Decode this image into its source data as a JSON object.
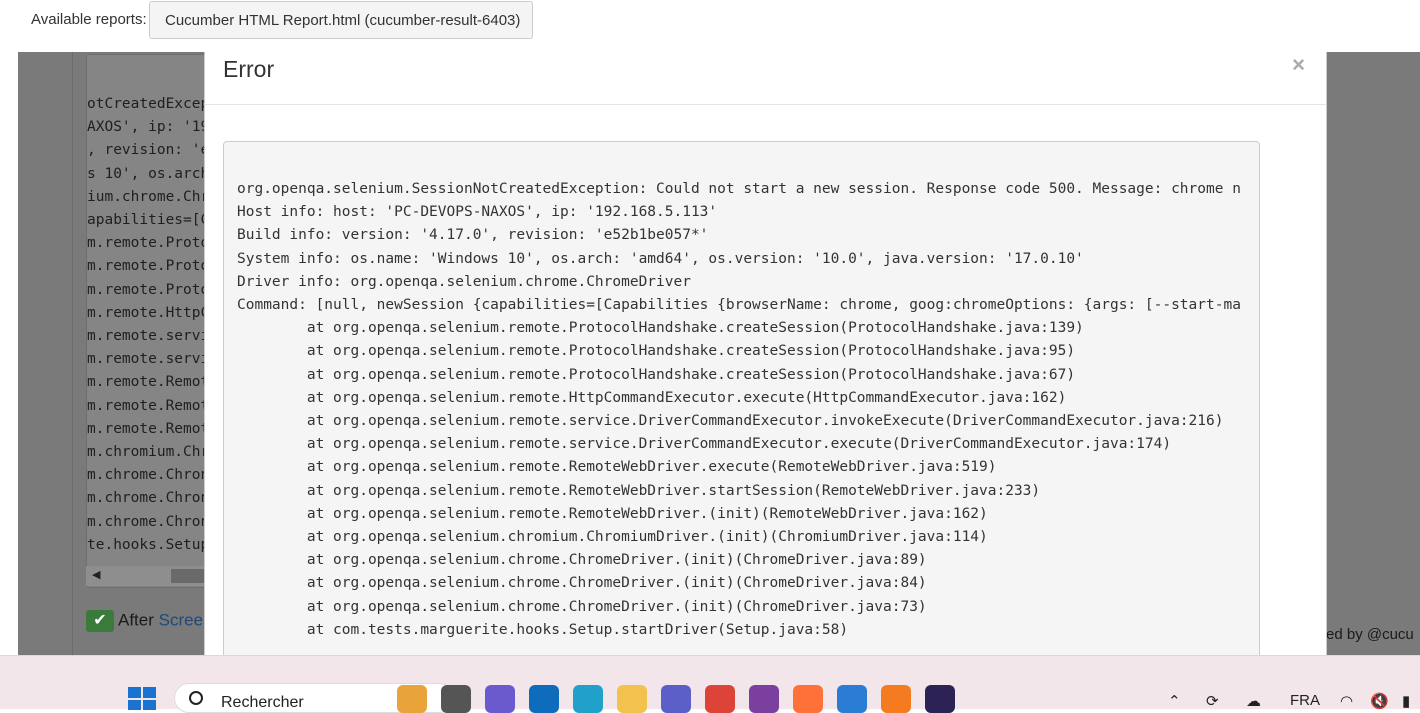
{
  "topbar": {
    "label": "Available reports:",
    "report": "Cucumber HTML Report.html (cucumber-result-6403)"
  },
  "background": {
    "code_lines": [
      "otCreatedExcep",
      "AXOS', ip: '19",
      ", revision: 'e",
      "s 10', os.arch",
      "ium.chrome.Chr",
      "apabilities=[C",
      "m.remote.Proto",
      "m.remote.Proto",
      "m.remote.Proto",
      "m.remote.HttpC",
      "m.remote.servi",
      "m.remote.servi",
      "m.remote.Remot",
      "m.remote.Remot",
      "m.remote.Remot",
      "m.chromium.Chr",
      "m.chrome.Chron",
      "m.chrome.Chron",
      "m.chrome.Chron",
      "te.hooks.Setup"
    ],
    "after_label": "After",
    "after_link": "Scree",
    "powered_text": "ed by @cucu"
  },
  "modal": {
    "title": "Error",
    "close": "×",
    "error_lines": [
      "org.openqa.selenium.SessionNotCreatedException: Could not start a new session. Response code 500. Message: chrome n",
      "Host info: host: 'PC-DEVOPS-NAXOS', ip: '192.168.5.113'",
      "Build info: version: '4.17.0', revision: 'e52b1be057*'",
      "System info: os.name: 'Windows 10', os.arch: 'amd64', os.version: '10.0', java.version: '17.0.10'",
      "Driver info: org.openqa.selenium.chrome.ChromeDriver",
      "Command: [null, newSession {capabilities=[Capabilities {browserName: chrome, goog:chromeOptions: {args: [--start-ma",
      "\tat org.openqa.selenium.remote.ProtocolHandshake.createSession(ProtocolHandshake.java:139)",
      "\tat org.openqa.selenium.remote.ProtocolHandshake.createSession(ProtocolHandshake.java:95)",
      "\tat org.openqa.selenium.remote.ProtocolHandshake.createSession(ProtocolHandshake.java:67)",
      "\tat org.openqa.selenium.remote.HttpCommandExecutor.execute(HttpCommandExecutor.java:162)",
      "\tat org.openqa.selenium.remote.service.DriverCommandExecutor.invokeExecute(DriverCommandExecutor.java:216)",
      "\tat org.openqa.selenium.remote.service.DriverCommandExecutor.execute(DriverCommandExecutor.java:174)",
      "\tat org.openqa.selenium.remote.RemoteWebDriver.execute(RemoteWebDriver.java:519)",
      "\tat org.openqa.selenium.remote.RemoteWebDriver.startSession(RemoteWebDriver.java:233)",
      "\tat org.openqa.selenium.remote.RemoteWebDriver.(init)(RemoteWebDriver.java:162)",
      "\tat org.openqa.selenium.chromium.ChromiumDriver.(init)(ChromiumDriver.java:114)",
      "\tat org.openqa.selenium.chrome.ChromeDriver.(init)(ChromeDriver.java:89)",
      "\tat org.openqa.selenium.chrome.ChromeDriver.(init)(ChromeDriver.java:84)",
      "\tat org.openqa.selenium.chrome.ChromeDriver.(init)(ChromeDriver.java:73)",
      "\tat com.tests.marguerite.hooks.Setup.startDriver(Setup.java:58)"
    ]
  },
  "taskbar": {
    "search_placeholder": "Rechercher",
    "language": "FRA",
    "apps": [
      {
        "name": "briefcase-icon",
        "color": "#e8a33b"
      },
      {
        "name": "terminal-icon",
        "color": "#555555"
      },
      {
        "name": "video-chat-icon",
        "color": "#6a5acd"
      },
      {
        "name": "outlook-icon",
        "color": "#0f6cbd"
      },
      {
        "name": "edge-icon",
        "color": "#1fa1c9"
      },
      {
        "name": "file-explorer-icon",
        "color": "#f2c14e"
      },
      {
        "name": "teams-icon",
        "color": "#5b5fc7"
      },
      {
        "name": "chrome-icon",
        "color": "#db4437"
      },
      {
        "name": "dev-tool-icon",
        "color": "#7b3fa0"
      },
      {
        "name": "firefox-icon",
        "color": "#ff7139"
      },
      {
        "name": "calculator-icon",
        "color": "#2b7cd3"
      },
      {
        "name": "git-tool-icon",
        "color": "#f47b20"
      },
      {
        "name": "eclipse-icon",
        "color": "#2c2255"
      }
    ]
  }
}
